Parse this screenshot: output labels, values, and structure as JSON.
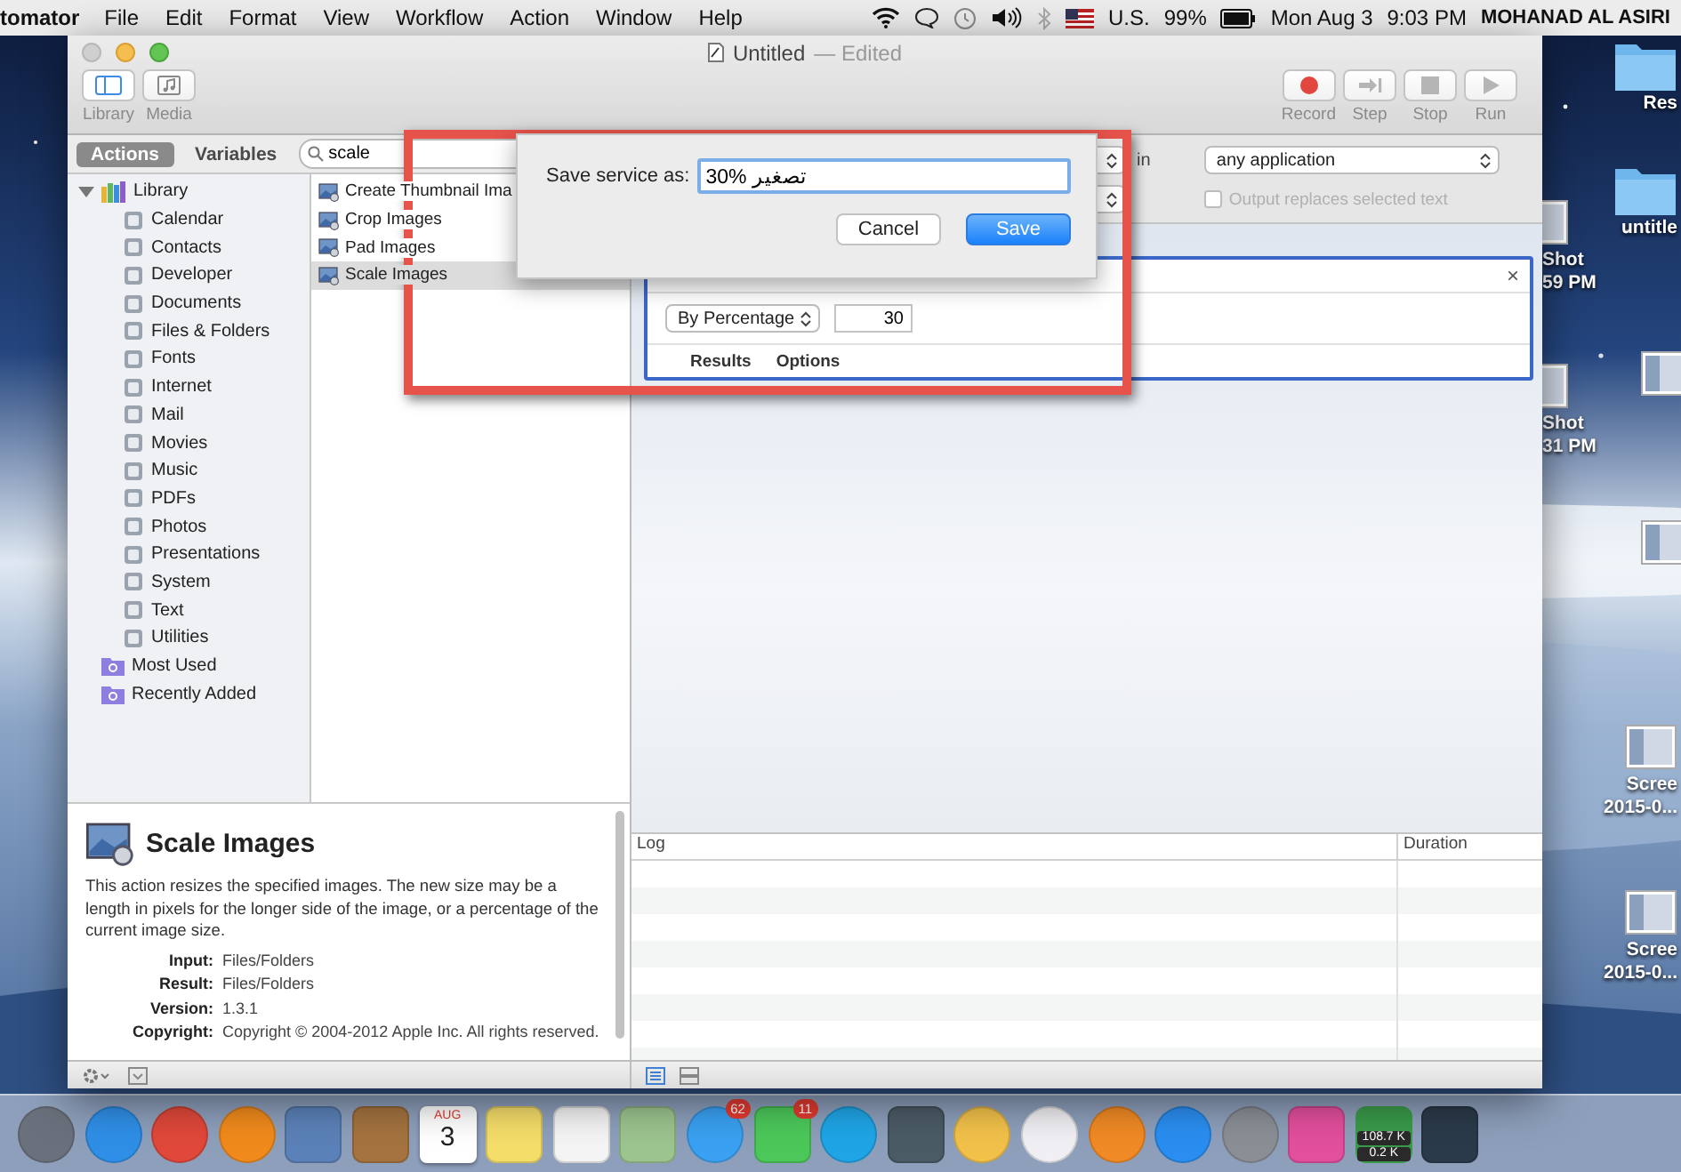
{
  "menu_bar": {
    "app": "tomator",
    "menus": [
      "File",
      "Edit",
      "Format",
      "View",
      "Workflow",
      "Action",
      "Window",
      "Help"
    ],
    "input_source": "U.S.",
    "battery": "99%",
    "date": "Mon Aug 3",
    "time": "9:03 PM",
    "user": "MOHANAD AL ASIRI"
  },
  "window": {
    "title": "Untitled",
    "status": "— Edited",
    "left_tools": [
      {
        "label": "Library",
        "kind": "library",
        "selected": true
      },
      {
        "label": "Media",
        "kind": "media",
        "selected": false
      }
    ],
    "right_tools": [
      {
        "label": "Record",
        "kind": "record",
        "disabled": false
      },
      {
        "label": "Step",
        "kind": "step",
        "disabled": true
      },
      {
        "label": "Stop",
        "kind": "stop",
        "disabled": true
      },
      {
        "label": "Run",
        "kind": "run",
        "disabled": true
      }
    ]
  },
  "library": {
    "tabs": [
      {
        "label": "Actions",
        "selected": true
      },
      {
        "label": "Variables",
        "selected": false
      }
    ],
    "search": {
      "value": "scale"
    },
    "tree": [
      {
        "label": "Library",
        "expanded": true,
        "children": [
          {
            "label": "Calendar"
          },
          {
            "label": "Contacts"
          },
          {
            "label": "Developer"
          },
          {
            "label": "Documents"
          },
          {
            "label": "Files & Folders"
          },
          {
            "label": "Fonts"
          },
          {
            "label": "Internet"
          },
          {
            "label": "Mail"
          },
          {
            "label": "Movies"
          },
          {
            "label": "Music"
          },
          {
            "label": "PDFs"
          },
          {
            "label": "Photos"
          },
          {
            "label": "Presentations"
          },
          {
            "label": "System"
          },
          {
            "label": "Text"
          },
          {
            "label": "Utilities"
          }
        ]
      },
      {
        "label": "Most Used"
      },
      {
        "label": "Recently Added"
      }
    ],
    "actions": [
      {
        "label": "Create Thumbnail Ima",
        "selected": false
      },
      {
        "label": "Crop Images",
        "selected": false
      },
      {
        "label": "Pad Images",
        "selected": false
      },
      {
        "label": "Scale Images",
        "selected": true
      }
    ]
  },
  "description": {
    "title": "Scale Images",
    "text": "This action resizes the specified images. The new size may be a length in pixels for the longer side of the image, or a percentage of the current image size.",
    "fields": [
      {
        "label": "Input:",
        "value": "Files/Folders"
      },
      {
        "label": "Result:",
        "value": "Files/Folders"
      },
      {
        "label": "Version:",
        "value": "1.3.1"
      },
      {
        "label": "Copyright:",
        "value": "Copyright © 2004-2012 Apple Inc.  All rights reserved."
      }
    ]
  },
  "workflow": {
    "in_label": "in",
    "application": "any application",
    "output_replaces": {
      "label": "Output replaces selected text",
      "checked": false,
      "disabled": true
    },
    "action": {
      "close": "×",
      "mode": "By Percentage",
      "amount": "30",
      "tabs": [
        "Results",
        "Options"
      ]
    }
  },
  "log": {
    "columns": [
      "Log",
      "Duration"
    ]
  },
  "dialog": {
    "label": "Save service as:",
    "value": "30% تصغير",
    "buttons": [
      {
        "label": "Cancel",
        "kind": "normal"
      },
      {
        "label": "Save",
        "kind": "default"
      }
    ]
  },
  "desktop": {
    "items": [
      {
        "kind": "folder",
        "lines": [
          "Res"
        ]
      },
      {
        "kind": "folder",
        "lines": [
          "untitle"
        ]
      },
      {
        "kind": "screenshot",
        "lines": [
          "Shot",
          "59 PM"
        ]
      },
      {
        "kind": "screenshot",
        "lines": [
          "Shot",
          "31 PM"
        ]
      },
      {
        "kind": "screenshot"
      },
      {
        "kind": "screenshot"
      },
      {
        "kind": "screenshot",
        "lines": [
          "Scree",
          "2015-0..."
        ]
      },
      {
        "kind": "screenshot",
        "lines": [
          "Scree",
          "2015-0..."
        ]
      }
    ]
  },
  "dock": {
    "items": [
      {
        "kind": "round",
        "color": "#6b717c"
      },
      {
        "kind": "round",
        "color": "#2f8fe6"
      },
      {
        "kind": "round",
        "color": "#e0483a"
      },
      {
        "kind": "round",
        "color": "#f08a1c"
      },
      {
        "kind": "tile",
        "color": "#5b82b8"
      },
      {
        "kind": "tile",
        "color": "#a4733f"
      },
      {
        "kind": "calendar",
        "month": "AUG",
        "day": "3"
      },
      {
        "kind": "tile",
        "color": "#f5dd6a"
      },
      {
        "kind": "tile",
        "color": "#f4f4f4"
      },
      {
        "kind": "tile",
        "color": "#9cc48f"
      },
      {
        "kind": "round",
        "color": "#3aa1f2",
        "badge": "62"
      },
      {
        "kind": "tile",
        "color": "#4cc85a",
        "badge": "11"
      },
      {
        "kind": "round",
        "color": "#1fa5e6"
      },
      {
        "kind": "tile",
        "color": "#4b5b66"
      },
      {
        "kind": "round",
        "color": "#f2c14a"
      },
      {
        "kind": "round",
        "color": "#f0f0f4"
      },
      {
        "kind": "round",
        "color": "#f08a24"
      },
      {
        "kind": "round",
        "color": "#2a8ef0"
      },
      {
        "kind": "round",
        "color": "#8a8f96"
      },
      {
        "kind": "tile",
        "color": "#e24f9c"
      },
      {
        "kind": "meter",
        "upload": "108.7 K",
        "download": "0.2 K"
      },
      {
        "kind": "tile",
        "color": "#2b3a4a"
      }
    ]
  }
}
